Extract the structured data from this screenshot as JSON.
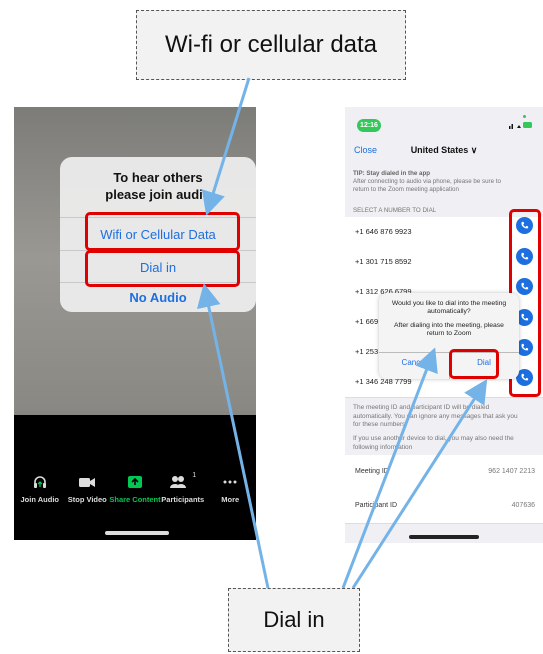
{
  "callouts": {
    "top": "Wi-fi or cellular data",
    "bottom": "Dial in"
  },
  "left_phone": {
    "dialog": {
      "title_line1": "To hear others",
      "title_line2": "please join audio",
      "option_wifi": "Wifi or Cellular Data",
      "option_dial": "Dial in",
      "option_no_audio": "No Audio"
    },
    "toolbar": {
      "join_audio": "Join Audio",
      "stop_video": "Stop Video",
      "share_content": "Share Content",
      "participants": "Participants",
      "participants_count": "1",
      "more": "More"
    }
  },
  "right_phone": {
    "status": {
      "time": "12:16"
    },
    "nav": {
      "close": "Close",
      "country": "United States ∨"
    },
    "tip": {
      "title": "TIP: Stay dialed in the app",
      "line1": "After connecting to audio via phone, please be sure to",
      "line2": "return to the Zoom meeting application"
    },
    "section_header": "SELECT A NUMBER TO DIAL",
    "numbers": [
      "+1 646 876 9923",
      "+1 301 715 8592",
      "+1 312 626 6799",
      "+1 669",
      "+1 253",
      "+1 346 248 7799"
    ],
    "note1": {
      "line1": "The meeting ID and participant ID will be dialed",
      "line2": "automatically. You can ignore any messages that ask you",
      "line3": "for these numbers."
    },
    "note2": {
      "line1": "If you use another device to dial, you may also need the",
      "line2": "following information"
    },
    "meeting_id_label": "Meeting ID",
    "meeting_id_value": "962 1407 2213",
    "participant_id_label": "Participant ID",
    "participant_id_value": "407636",
    "dial_dialog": {
      "line1": "Would you like to dial into the meeting",
      "line2": "automatically?",
      "line3": "After dialing into the meeting, please",
      "line4": "return to Zoom",
      "cancel": "Cancel",
      "dial": "Dial"
    }
  },
  "colors": {
    "highlight": "#e00000",
    "arrow": "#74b3e8",
    "ios_blue": "#1d6fe0",
    "share_green": "#00c853"
  }
}
